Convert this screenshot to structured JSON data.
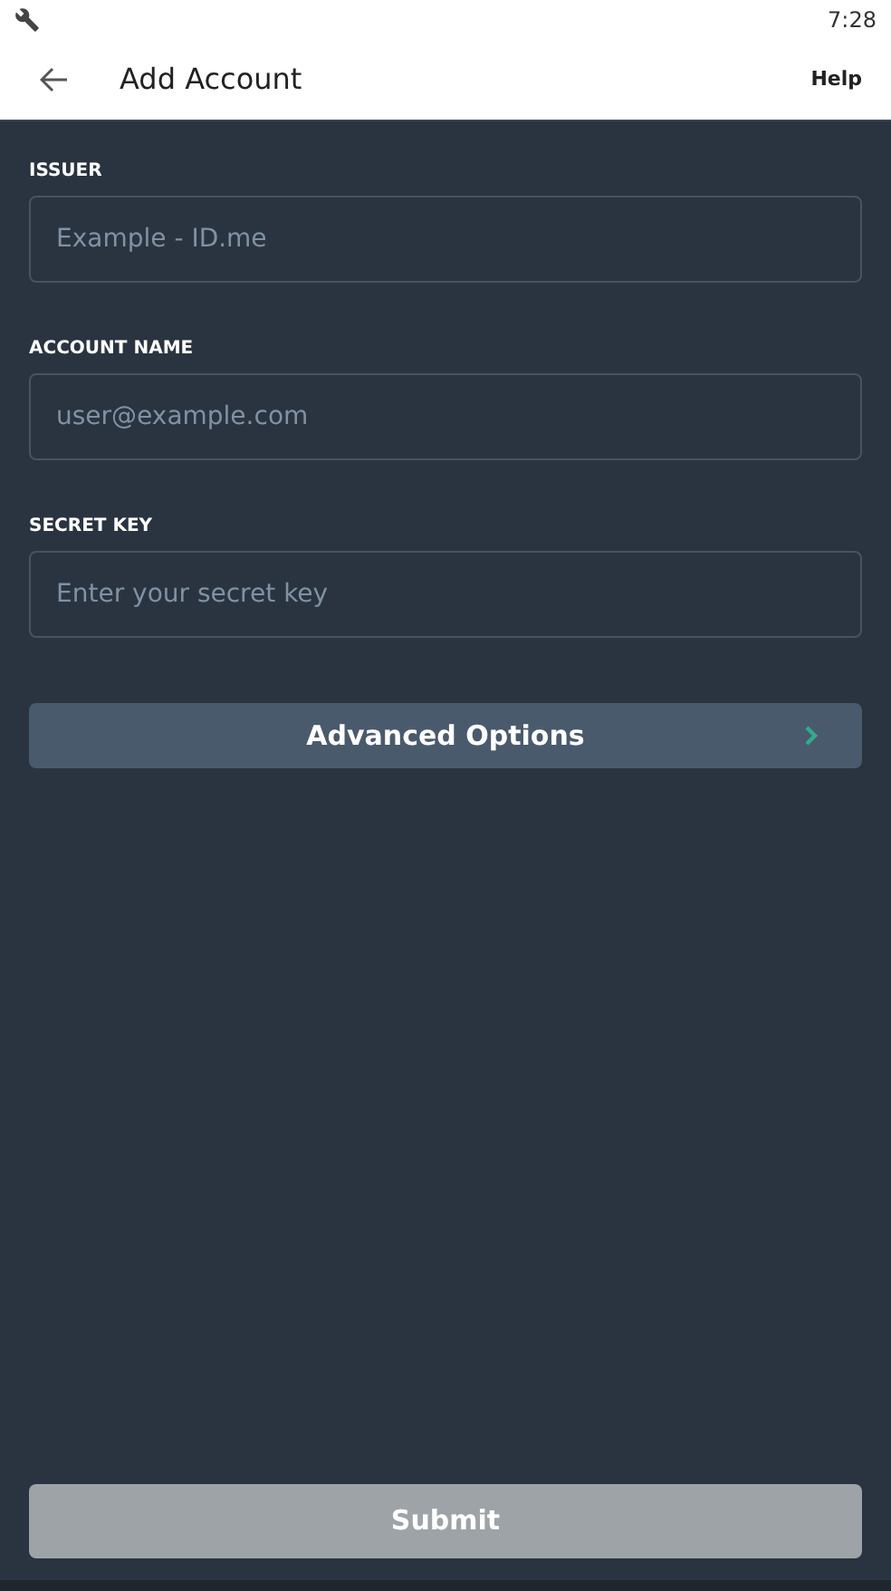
{
  "status_bar": {
    "time": "7:28"
  },
  "app_bar": {
    "title": "Add Account",
    "action": "Help"
  },
  "fields": [
    {
      "label": "ISSUER",
      "placeholder": "Example - ID.me"
    },
    {
      "label": "ACCOUNT NAME",
      "placeholder": "user@example.com"
    },
    {
      "label": "SECRET KEY",
      "placeholder": "Enter your secret key"
    }
  ],
  "advanced_button": {
    "label": "Advanced Options"
  },
  "submit_button": {
    "label": "Submit",
    "disabled": true
  }
}
